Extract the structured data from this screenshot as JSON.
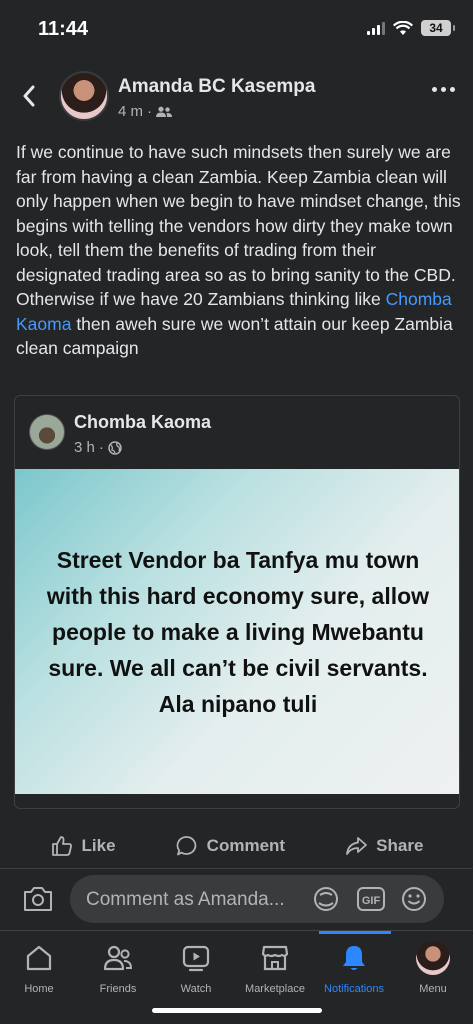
{
  "status": {
    "time": "11:44",
    "battery": "34"
  },
  "post": {
    "author": "Amanda BC Kasempa",
    "time": "4 m",
    "text_before": "If we continue to have such mindsets then surely we are far from having a clean Zambia. Keep Zambia clean will only happen when we begin to have mindset change, this begins with telling the vendors how dirty they make town look, tell them the benefits of trading from their designated trading area so as to bring sanity to the CBD. Otherwise if we have 20 Zambians thinking like ",
    "mention": "Chomba Kaoma",
    "text_after": " then aweh sure we won’t attain our keep Zambia clean campaign"
  },
  "shared": {
    "author": "Chomba Kaoma",
    "time": "3 h",
    "image_text": "Street Vendor ba Tanfya mu town with this hard economy sure, allow people to make a living Mwebantu sure. We all can’t be civil servants. Ala nipano tuli"
  },
  "actions": {
    "like": "Like",
    "comment": "Comment",
    "share": "Share"
  },
  "comment_box": {
    "placeholder": "Comment as Amanda..."
  },
  "nav": {
    "home": "Home",
    "friends": "Friends",
    "watch": "Watch",
    "marketplace": "Marketplace",
    "notifications": "Notifications",
    "menu": "Menu"
  },
  "colors": {
    "accent": "#2d88ff",
    "mention": "#4599ff",
    "background": "#242526"
  }
}
